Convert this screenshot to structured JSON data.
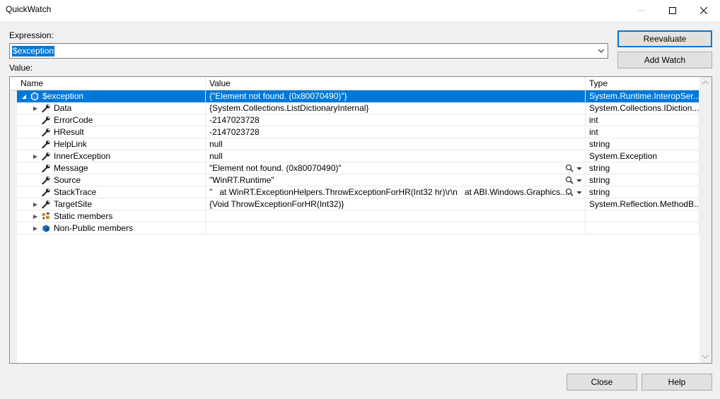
{
  "window": {
    "title": "QuickWatch"
  },
  "expression": {
    "label": "Expression:",
    "value": "$exception"
  },
  "value_label": "Value:",
  "buttons": {
    "reevaluate": "Reevaluate",
    "add_watch": "Add Watch",
    "close": "Close",
    "help": "Help"
  },
  "columns": {
    "name": "Name",
    "value": "Value",
    "type": "Type"
  },
  "rows": [
    {
      "name": "$exception",
      "value": "{\"Element not found. (0x80070490)\"}",
      "type": "System.Runtime.InteropSer...",
      "expander": "expanded",
      "icon": "exception-object-icon",
      "selected": true,
      "visualizer": false
    },
    {
      "name": "Data",
      "value": "{System.Collections.ListDictionaryInternal}",
      "type": "System.Collections.IDiction...",
      "expander": "collapsed",
      "icon": "wrench-icon",
      "selected": false,
      "visualizer": false
    },
    {
      "name": "ErrorCode",
      "value": "-2147023728",
      "type": "int",
      "expander": "none",
      "icon": "wrench-icon",
      "selected": false,
      "visualizer": false
    },
    {
      "name": "HResult",
      "value": "-2147023728",
      "type": "int",
      "expander": "none",
      "icon": "wrench-icon",
      "selected": false,
      "visualizer": false
    },
    {
      "name": "HelpLink",
      "value": "null",
      "type": "string",
      "expander": "none",
      "icon": "wrench-icon",
      "selected": false,
      "visualizer": false
    },
    {
      "name": "InnerException",
      "value": "null",
      "type": "System.Exception",
      "expander": "collapsed",
      "icon": "wrench-icon",
      "selected": false,
      "visualizer": false
    },
    {
      "name": "Message",
      "value": "\"Element not found. (0x80070490)\"",
      "type": "string",
      "expander": "none",
      "icon": "wrench-icon",
      "selected": false,
      "visualizer": true
    },
    {
      "name": "Source",
      "value": "\"WinRT.Runtime\"",
      "type": "string",
      "expander": "none",
      "icon": "wrench-icon",
      "selected": false,
      "visualizer": true
    },
    {
      "name": "StackTrace",
      "value": "\"   at WinRT.ExceptionHelpers.ThrowExceptionForHR(Int32 hr)\\r\\n   at ABI.Windows.Graphics....",
      "type": "string",
      "expander": "none",
      "icon": "wrench-icon",
      "selected": false,
      "visualizer": true
    },
    {
      "name": "TargetSite",
      "value": "{Void ThrowExceptionForHR(Int32)}",
      "type": "System.Reflection.MethodB...",
      "expander": "collapsed",
      "icon": "wrench-icon",
      "selected": false,
      "visualizer": false
    },
    {
      "name": "Static members",
      "value": "",
      "type": "",
      "expander": "collapsed",
      "icon": "static-members-icon",
      "selected": false,
      "visualizer": false
    },
    {
      "name": "Non-Public members",
      "value": "",
      "type": "",
      "expander": "collapsed",
      "icon": "non-public-members-icon",
      "selected": false,
      "visualizer": false
    }
  ],
  "colors": {
    "accent": "#0078d7",
    "window_bg": "#f0f0f0",
    "selection": "#0078d7"
  }
}
